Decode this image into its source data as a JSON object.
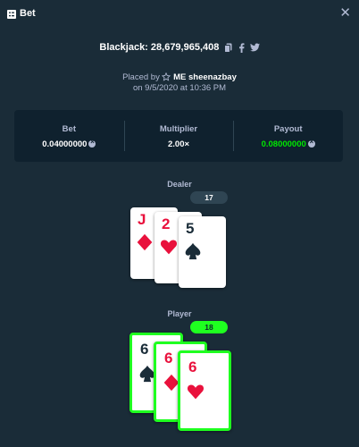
{
  "header": {
    "title": "Bet",
    "icon": "bet-slip-icon",
    "close_icon": "close-icon"
  },
  "game": {
    "title": "Blackjack: 28,679,965,408",
    "copy_icon": "copy-icon",
    "facebook_icon": "facebook-icon",
    "twitter_icon": "twitter-icon"
  },
  "placed": {
    "prefix": "Placed by",
    "user": "ME sheenazbay",
    "date": "on 9/5/2020 at 10:36 PM",
    "icon": "star-icon"
  },
  "stats": {
    "bet": {
      "label": "Bet",
      "value": "0.04000000",
      "currency_icon": "currency-icon"
    },
    "multiplier": {
      "label": "Multiplier",
      "value": "2.00×"
    },
    "payout": {
      "label": "Payout",
      "value": "0.08000000",
      "currency_icon": "currency-icon"
    }
  },
  "dealer": {
    "label": "Dealer",
    "total": "17",
    "cards": [
      {
        "rank": "J",
        "suit": "diamond"
      },
      {
        "rank": "2",
        "suit": "heart"
      },
      {
        "rank": "5",
        "suit": "spade"
      }
    ]
  },
  "player": {
    "label": "Player",
    "total": "18",
    "cards": [
      {
        "rank": "6",
        "suit": "spade"
      },
      {
        "rank": "6",
        "suit": "diamond"
      },
      {
        "rank": "6",
        "suit": "heart"
      }
    ]
  },
  "colors": {
    "background": "#1a2c38",
    "panel": "#0f212e",
    "win_green": "#1fff20",
    "payout_green": "#00e701",
    "red_suit": "#e9113c"
  }
}
